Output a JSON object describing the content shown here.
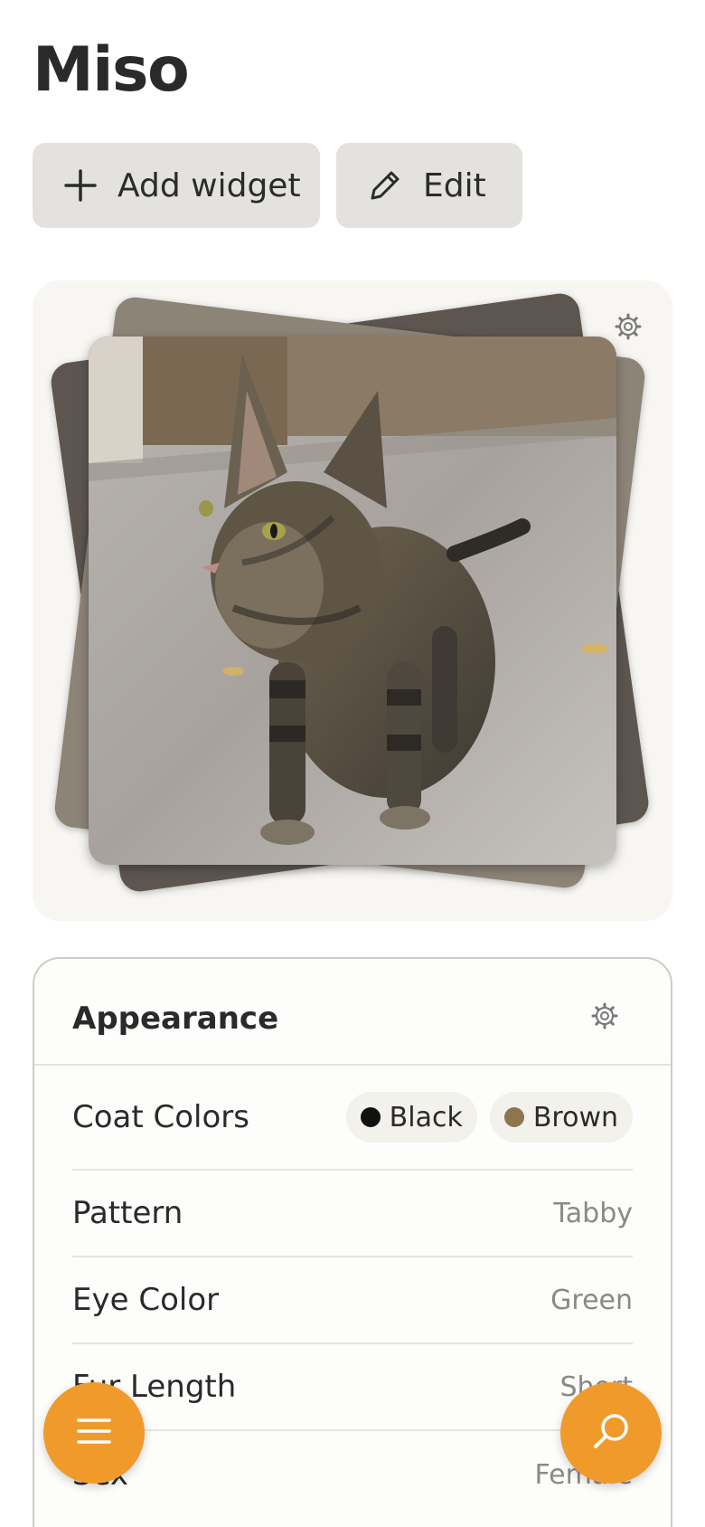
{
  "page": {
    "title": "Miso"
  },
  "actions": {
    "add_widget_label": "Add widget",
    "edit_label": "Edit"
  },
  "photo_widget": {
    "settings_icon": "gear-icon",
    "photo_subject": "tabby-cat"
  },
  "appearance": {
    "title": "Appearance",
    "settings_icon": "gear-icon",
    "coat_colors": {
      "label": "Coat Colors",
      "chips": [
        {
          "label": "Black",
          "color": "#111111"
        },
        {
          "label": "Brown",
          "color": "#8f7450"
        }
      ]
    },
    "rows": [
      {
        "label": "Pattern",
        "value": "Tabby"
      },
      {
        "label": "Eye Color",
        "value": "Green"
      },
      {
        "label": "Fur Length",
        "value": "Short"
      },
      {
        "label": "Sex",
        "value": "Female"
      }
    ]
  },
  "fabs": {
    "menu_icon": "hamburger-menu-icon",
    "search_icon": "search-icon",
    "accent": "#f09a2c"
  }
}
